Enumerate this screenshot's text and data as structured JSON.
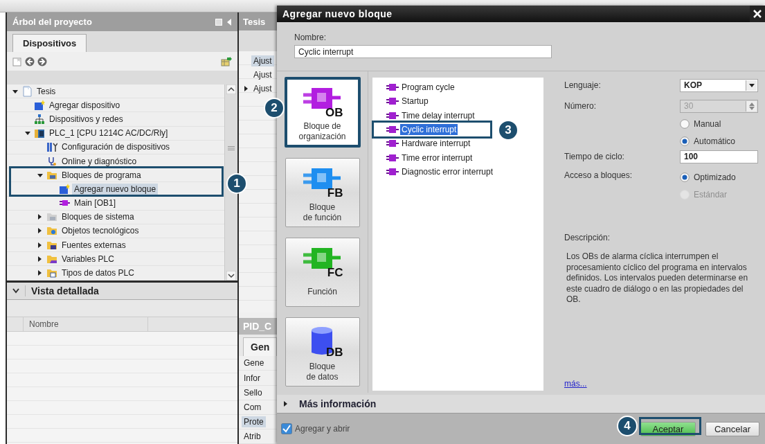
{
  "project_tree": {
    "title": "Árbol del proyecto",
    "tabs": [
      {
        "label": "Dispositivos",
        "selected": true
      }
    ],
    "items": [
      {
        "label": "Tesis",
        "kind": "doc",
        "expanded": true,
        "selected": false,
        "children": [
          {
            "label": "Agregar dispositivo",
            "kind": "add",
            "selected": false
          },
          {
            "label": "Dispositivos y redes",
            "kind": "network",
            "selected": false
          },
          {
            "label": "PLC_1 [CPU 1214C AC/DC/Rly]",
            "kind": "plc",
            "expanded": true,
            "selected": false,
            "children": [
              {
                "label": "Configuración de dispositivos",
                "kind": "config",
                "selected": false
              },
              {
                "label": "Online y diagnóstico",
                "kind": "online",
                "selected": false
              },
              {
                "label": "Bloques de programa",
                "kind": "folder-blocks",
                "expanded": true,
                "selected": false,
                "children": [
                  {
                    "label": "Agregar nuevo bloque",
                    "kind": "add",
                    "selected": true
                  },
                  {
                    "label": "Main [OB1]",
                    "kind": "block",
                    "selected": false
                  }
                ]
              },
              {
                "label": "Bloques de sistema",
                "kind": "folder-system",
                "expanded": false,
                "selected": false
              },
              {
                "label": "Objetos tecnológicos",
                "kind": "folder-tech",
                "expanded": false,
                "selected": false
              },
              {
                "label": "Fuentes externas",
                "kind": "folder-source",
                "expanded": false,
                "selected": false
              },
              {
                "label": "Variables PLC",
                "kind": "folder-vars",
                "expanded": false,
                "selected": false
              },
              {
                "label": "Tipos de datos PLC",
                "kind": "folder-types",
                "expanded": false,
                "selected": false
              }
            ]
          }
        ]
      }
    ]
  },
  "detail_view": {
    "title": "Vista detallada",
    "expanded": true,
    "columns": [
      "Nombre"
    ]
  },
  "editor": {
    "title": "Tesis",
    "rows": [
      {
        "label": "Ajust",
        "selected": true,
        "expanded": null
      },
      {
        "label": "Ajust",
        "selected": false,
        "expanded": null
      },
      {
        "label": "Ajust",
        "selected": false,
        "expanded": false
      }
    ]
  },
  "properties": {
    "title": "PID_C",
    "tabs": [
      {
        "label": "Gen",
        "selected": true
      }
    ],
    "rows": [
      {
        "label": "Gene",
        "selected": false
      },
      {
        "label": "Infor",
        "selected": false
      },
      {
        "label": "Sello",
        "selected": false
      },
      {
        "label": "Com",
        "selected": false
      },
      {
        "label": "Prote",
        "selected": true
      },
      {
        "label": "Atrib",
        "selected": false
      }
    ]
  },
  "dialog": {
    "title": "Agregar nuevo bloque",
    "name_label": "Nombre:",
    "name_value": "Cyclic interrupt",
    "block_types": [
      {
        "code": "OB",
        "label": "Bloque de\norganización",
        "color": "#b21ee0",
        "selected": true
      },
      {
        "code": "FB",
        "label": "Bloque\nde función",
        "color": "#1e8ef0",
        "selected": false
      },
      {
        "code": "FC",
        "label": "Función",
        "color": "#22b422",
        "selected": false
      },
      {
        "code": "DB",
        "label": "Bloque\nde datos",
        "color": "#3d4ff0",
        "selected": false
      }
    ],
    "ob_types": [
      {
        "label": "Program cycle",
        "selected": false
      },
      {
        "label": "Startup",
        "selected": false
      },
      {
        "label": "Time delay interrupt",
        "selected": false
      },
      {
        "label": "Cyclic interrupt",
        "selected": true
      },
      {
        "label": "Hardware interrupt",
        "selected": false
      },
      {
        "label": "Time error interrupt",
        "selected": false
      },
      {
        "label": "Diagnostic error interrupt",
        "selected": false
      }
    ],
    "language": {
      "label": "Lenguaje:",
      "value": "KOP"
    },
    "number": {
      "label": "Número:",
      "value": "30",
      "disabled": true,
      "modes": [
        {
          "label": "Manual",
          "selected": false,
          "disabled": false
        },
        {
          "label": "Automático",
          "selected": true,
          "disabled": false
        }
      ]
    },
    "cycle_time": {
      "label": "Tiempo de ciclo:",
      "value": "100"
    },
    "block_access": {
      "label": "Acceso a bloques:",
      "options": [
        {
          "label": "Optimizado",
          "selected": true,
          "disabled": false
        },
        {
          "label": "Estándar",
          "selected": false,
          "disabled": true
        }
      ]
    },
    "description": {
      "label": "Descripción:",
      "text": "Los OBs de alarma cíclica interrumpen el procesamiento cíclico del programa en intervalos definidos. Los intervalos pueden determinarse en este cuadro de diálogo o en las propiedades del OB.",
      "link": "más..."
    },
    "more_info": {
      "label": "Más información",
      "expanded": false
    },
    "add_and_open": {
      "label": "Agregar y abrir",
      "checked": true
    },
    "buttons": [
      {
        "label": "Aceptar",
        "default": true
      },
      {
        "label": "Cancelar",
        "default": false
      }
    ]
  },
  "callouts": [
    {
      "number": "1"
    },
    {
      "number": "2"
    },
    {
      "number": "3"
    },
    {
      "number": "4"
    }
  ]
}
